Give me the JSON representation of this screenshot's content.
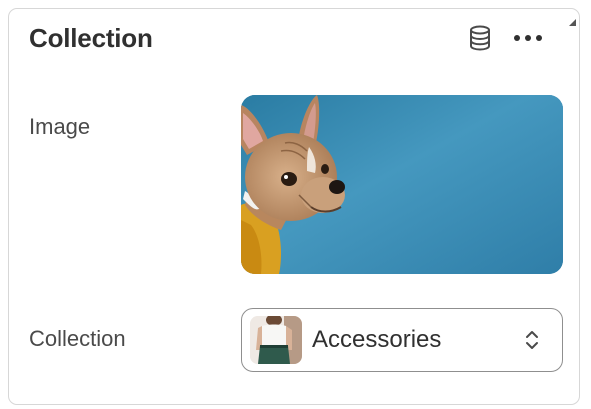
{
  "card": {
    "title": "Collection",
    "actions": [
      {
        "icon": "database-icon"
      },
      {
        "icon": "more-horizontal-icon"
      }
    ]
  },
  "fields": {
    "image": {
      "label": "Image",
      "thumbnail": "dog-photo"
    },
    "collection": {
      "label": "Collection",
      "value": "Accessories",
      "thumbnail": "accessories-photo"
    }
  },
  "colors": {
    "title_text": "#303030",
    "label_text": "#4a4a4a",
    "border": "#d7d7d7",
    "image_background": "#3d95be"
  }
}
